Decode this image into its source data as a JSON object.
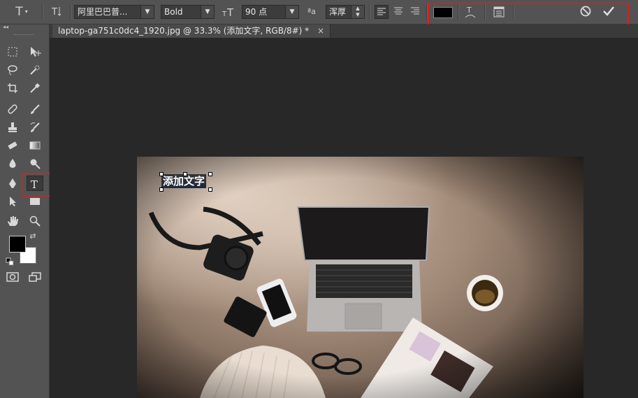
{
  "options_bar": {
    "font_family": "阿里巴巴普...",
    "font_style": "Bold",
    "font_size": "90 点",
    "antialias_prefix": "ªa",
    "antialias": "浑厚",
    "text_color": "#000000",
    "text_size_icon_glyph": "T"
  },
  "document": {
    "tab_title": "laptop-ga751c0dc4_1920.jpg @ 33.3% (添加文字, RGB/8#) *",
    "close_glyph": "×"
  },
  "canvas": {
    "text_layer": "添加文字"
  },
  "colors": {
    "foreground": "#000000",
    "background": "#ffffff",
    "highlight": "#d42020"
  },
  "icons": [
    "type-tool-icon",
    "text-orientation-icon",
    "align-left-icon",
    "align-center-icon",
    "align-right-icon",
    "warp-text-icon",
    "character-panel-icon",
    "cancel-icon",
    "commit-icon"
  ]
}
